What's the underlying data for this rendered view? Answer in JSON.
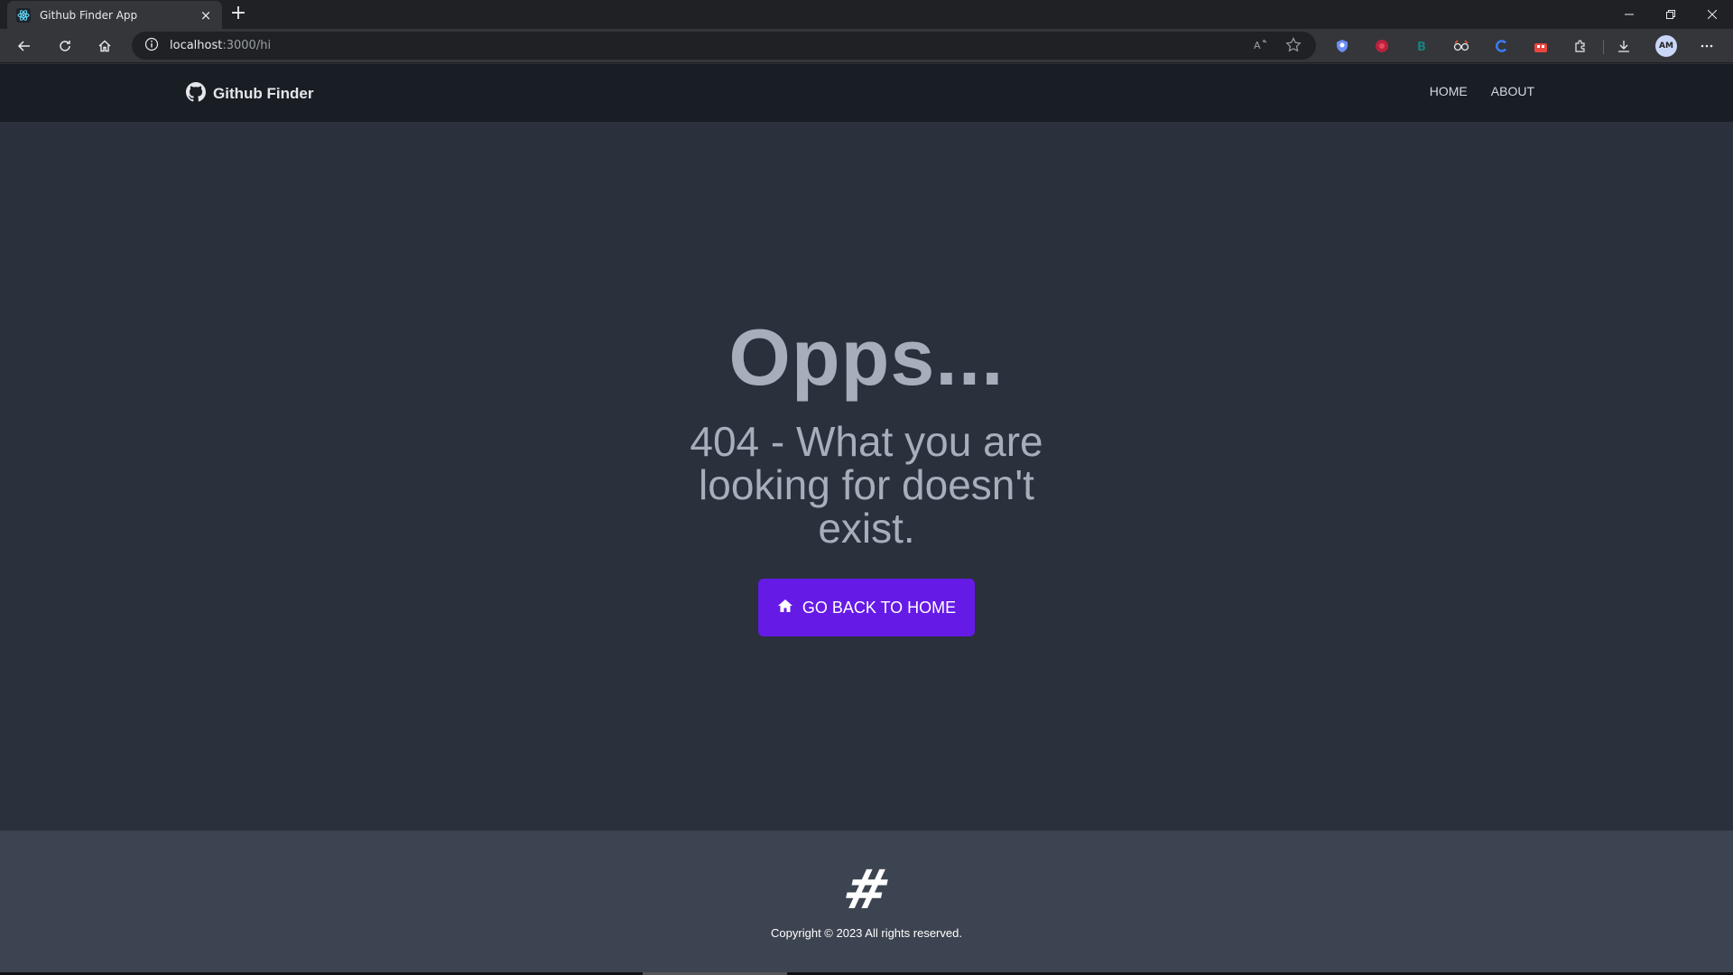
{
  "browser": {
    "tab_title": "Github Finder App",
    "tab_close": "×",
    "new_tab": "+",
    "url_host": "localhost",
    "url_path": ":3000/hi",
    "profile_initials": "AM"
  },
  "navbar": {
    "brand": "Github Finder",
    "links": [
      "HOME",
      "ABOUT"
    ]
  },
  "hero": {
    "title": "Opps...",
    "subtitle": "404 - What you are looking for doesn't exist.",
    "button_label": "GO BACK TO HOME"
  },
  "footer": {
    "logo": "#",
    "copyright": "Copyright © 2023 All rights reserved."
  },
  "colors": {
    "page_bg": "#2a303c",
    "navbar_bg": "#191d24",
    "footer_bg": "#3d4451",
    "primary": "#661ae6"
  }
}
